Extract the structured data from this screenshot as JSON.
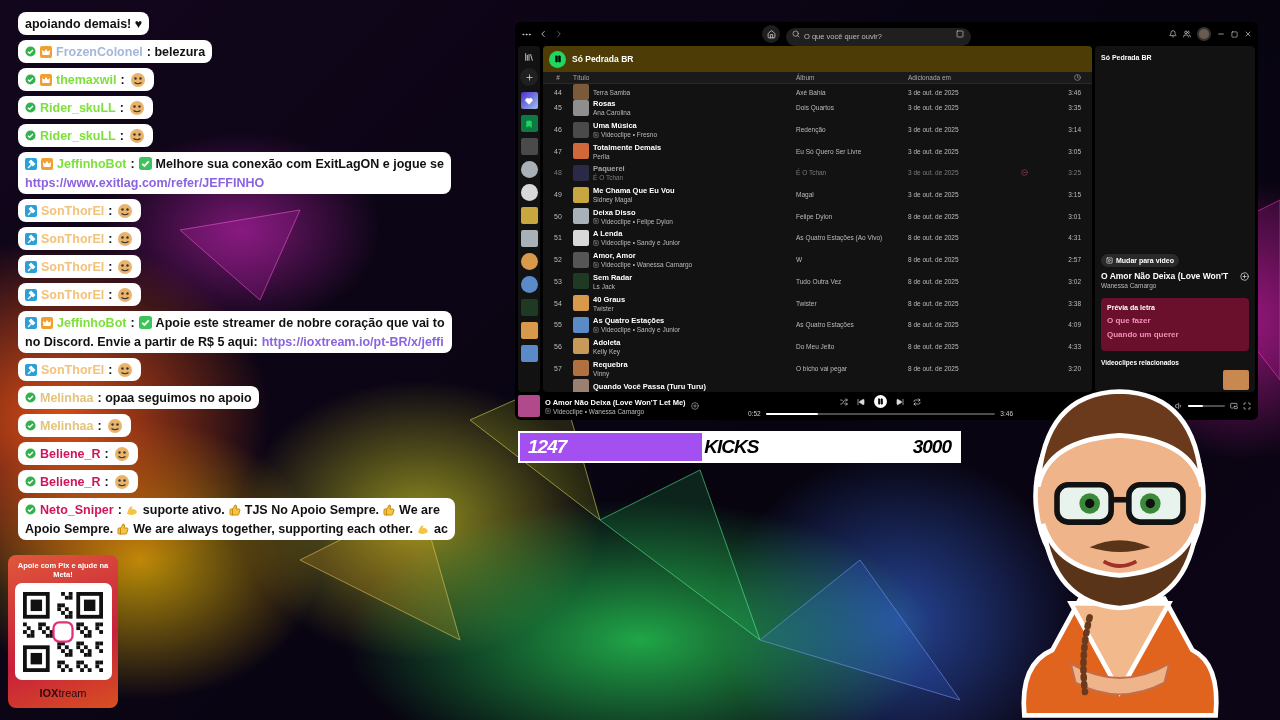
{
  "chat": {
    "messages": [
      {
        "lines": [
          [
            {
              "kind": "text",
              "text": "apoiando demais! ♥"
            }
          ]
        ]
      },
      {
        "badges": [
          {
            "kind": "verified"
          },
          {
            "kind": "crown"
          }
        ],
        "user": "FrozenColonel",
        "color": "#a3b6dc",
        "lines": [
          [
            {
              "kind": "text",
              "text": ": belezura"
            }
          ]
        ]
      },
      {
        "badges": [
          {
            "kind": "verified"
          },
          {
            "kind": "crown"
          }
        ],
        "user": "themaxwil",
        "color": "#7ee03a",
        "lines": [
          [
            {
              "kind": "text",
              "text": ":"
            },
            {
              "kind": "emote"
            }
          ]
        ]
      },
      {
        "badges": [
          {
            "kind": "verified"
          }
        ],
        "user": "Rider_skuLL",
        "color": "#7ee03a",
        "lines": [
          [
            {
              "kind": "text",
              "text": ":"
            },
            {
              "kind": "emote"
            }
          ]
        ]
      },
      {
        "badges": [
          {
            "kind": "verified"
          }
        ],
        "user": "Rider_skuLL",
        "color": "#7ee03a",
        "lines": [
          [
            {
              "kind": "text",
              "text": ":"
            },
            {
              "kind": "emote"
            }
          ]
        ]
      },
      {
        "badges": [
          {
            "kind": "mod"
          },
          {
            "kind": "crown"
          }
        ],
        "user": "JeffinhoBot",
        "color": "#7ee03a",
        "lines": [
          [
            {
              "kind": "text",
              "text": ":"
            },
            {
              "kind": "check"
            },
            {
              "kind": "text",
              "text": "Melhore sua conexão com ExitLagON e jogue se"
            }
          ],
          [
            {
              "kind": "link",
              "text": "https://www.exitlag.com/refer/JEFFINHO"
            }
          ]
        ]
      },
      {
        "badges": [
          {
            "kind": "mod"
          }
        ],
        "user": "SonThorEl",
        "color": "#f2c27a",
        "lines": [
          [
            {
              "kind": "text",
              "text": ":"
            },
            {
              "kind": "emote"
            }
          ]
        ]
      },
      {
        "badges": [
          {
            "kind": "mod"
          }
        ],
        "user": "SonThorEl",
        "color": "#f2c27a",
        "lines": [
          [
            {
              "kind": "text",
              "text": ":"
            },
            {
              "kind": "emote"
            }
          ]
        ]
      },
      {
        "badges": [
          {
            "kind": "mod"
          }
        ],
        "user": "SonThorEl",
        "color": "#f2c27a",
        "lines": [
          [
            {
              "kind": "text",
              "text": ":"
            },
            {
              "kind": "emote"
            }
          ]
        ]
      },
      {
        "badges": [
          {
            "kind": "mod"
          }
        ],
        "user": "SonThorEl",
        "color": "#f2c27a",
        "lines": [
          [
            {
              "kind": "text",
              "text": ":"
            },
            {
              "kind": "emote"
            }
          ]
        ]
      },
      {
        "badges": [
          {
            "kind": "mod"
          },
          {
            "kind": "crown"
          }
        ],
        "user": "JeffinhoBot",
        "color": "#7ee03a",
        "lines": [
          [
            {
              "kind": "text",
              "text": ":"
            },
            {
              "kind": "check"
            },
            {
              "kind": "text",
              "text": "Apoie este streamer de nobre coração que vai to"
            }
          ],
          [
            {
              "kind": "text",
              "text": "no Discord. Envie a partir de R$ 5 aqui:"
            },
            {
              "kind": "link",
              "text": "https://ioxtream.io/pt-BR/x/jeffi"
            }
          ]
        ]
      },
      {
        "badges": [
          {
            "kind": "mod"
          }
        ],
        "user": "SonThorEl",
        "color": "#f2c27a",
        "lines": [
          [
            {
              "kind": "text",
              "text": ":"
            },
            {
              "kind": "emote"
            }
          ]
        ]
      },
      {
        "badges": [
          {
            "kind": "verified"
          }
        ],
        "user": "Melinhaa",
        "color": "#e3c47a",
        "lines": [
          [
            {
              "kind": "text",
              "text": ": opaa seguimos no apoio"
            }
          ]
        ]
      },
      {
        "badges": [
          {
            "kind": "verified"
          }
        ],
        "user": "Melinhaa",
        "color": "#e3c47a",
        "lines": [
          [
            {
              "kind": "text",
              "text": ":"
            },
            {
              "kind": "emote"
            }
          ]
        ]
      },
      {
        "badges": [
          {
            "kind": "verified"
          }
        ],
        "user": "Beliene_R",
        "color": "#d1155a",
        "lines": [
          [
            {
              "kind": "text",
              "text": ":"
            },
            {
              "kind": "emote"
            }
          ]
        ]
      },
      {
        "badges": [
          {
            "kind": "verified"
          }
        ],
        "user": "Beliene_R",
        "color": "#d1155a",
        "lines": [
          [
            {
              "kind": "text",
              "text": ":"
            },
            {
              "kind": "emote"
            }
          ]
        ]
      },
      {
        "badges": [
          {
            "kind": "verified"
          }
        ],
        "user": "Neto_Sniper",
        "color": "#d1155a",
        "lines": [
          [
            {
              "kind": "text",
              "text": ":"
            },
            {
              "kind": "muscle"
            },
            {
              "kind": "text",
              "text": "suporte ativo."
            },
            {
              "kind": "thumbs"
            },
            {
              "kind": "text",
              "text": "TJS No Apoio Sempre."
            },
            {
              "kind": "thumbs"
            },
            {
              "kind": "text",
              "text": "We are"
            }
          ],
          [
            {
              "kind": "text",
              "text": "Apoio Sempre."
            },
            {
              "kind": "thumbs"
            },
            {
              "kind": "text",
              "text": "We are always together, supporting each other."
            },
            {
              "kind": "muscle"
            },
            {
              "kind": "text",
              "text": "ac"
            }
          ]
        ]
      }
    ]
  },
  "player_window": {
    "search": {
      "placeholder": "O que você quer ouvir?"
    },
    "library": [
      {
        "kind": "liked"
      },
      {
        "kind": "saved"
      },
      {
        "kind": "playlist"
      },
      {
        "kind": "artist"
      },
      {
        "kind": "artist"
      },
      {
        "kind": "playlist"
      },
      {
        "kind": "playlist"
      },
      {
        "kind": "artist"
      },
      {
        "kind": "artist"
      },
      {
        "kind": "playlist"
      },
      {
        "kind": "playlist"
      },
      {
        "kind": "playlist"
      }
    ],
    "playlist": {
      "title": "Só Pedrada BR",
      "playing": true
    },
    "columns": [
      "#",
      "Título",
      "Álbum",
      "Adicionada em"
    ],
    "tracks": [
      {
        "number": "44",
        "subtitle": "Terra Samba",
        "video": false,
        "album": "Axé Bahia",
        "added": "3 de out. de 2025",
        "duration": "3:46",
        "disabled": false
      },
      {
        "number": "45",
        "title": "Rosas",
        "subtitle": "Ana Carolina",
        "video": false,
        "album": "Dois Quartos",
        "added": "3 de out. de 2025",
        "duration": "3:35",
        "disabled": false
      },
      {
        "number": "46",
        "title": "Uma Música",
        "subtitle": "Videoclipe • Fresno",
        "video": true,
        "album": "Redenção",
        "added": "3 de out. de 2025",
        "duration": "3:14",
        "disabled": false
      },
      {
        "number": "47",
        "title": "Totalmente Demais",
        "subtitle": "Perlla",
        "video": false,
        "album": "Eu Só Quero Ser Livre",
        "added": "3 de out. de 2025",
        "duration": "3:05",
        "disabled": false
      },
      {
        "number": "48",
        "title": "Paquerei",
        "subtitle": "É O Tchan",
        "video": false,
        "album": "É O Tchan",
        "added": "3 de out. de 2025",
        "duration": "3:25",
        "disabled": true
      },
      {
        "number": "49",
        "title": "Me Chama Que Eu Vou",
        "subtitle": "Sidney Magal",
        "video": false,
        "album": "Magal",
        "added": "3 de out. de 2025",
        "duration": "3:15",
        "disabled": false
      },
      {
        "number": "50",
        "title": "Deixa Disso",
        "subtitle": "Videoclipe • Felipe Dylon",
        "video": true,
        "album": "Felipe Dylon",
        "added": "8 de out. de 2025",
        "duration": "3:01",
        "disabled": false
      },
      {
        "number": "51",
        "title": "A Lenda",
        "subtitle": "Videoclipe • Sandy e Junior",
        "video": true,
        "album": "As Quatro Estações (Ao Vivo)",
        "added": "8 de out. de 2025",
        "duration": "4:31",
        "disabled": false
      },
      {
        "number": "52",
        "title": "Amor, Amor",
        "subtitle": "Videoclipe • Wanessa Camargo",
        "video": true,
        "album": "W",
        "added": "8 de out. de 2025",
        "duration": "2:57",
        "disabled": false
      },
      {
        "number": "53",
        "title": "Sem Radar",
        "subtitle": "Ls Jack",
        "video": false,
        "album": "Tudo Outra Vez",
        "added": "8 de out. de 2025",
        "duration": "3:02",
        "disabled": false
      },
      {
        "number": "54",
        "title": "40 Graus",
        "subtitle": "Twister",
        "video": false,
        "album": "Twister",
        "added": "8 de out. de 2025",
        "duration": "3:38",
        "disabled": false
      },
      {
        "number": "55",
        "title": "As Quatro Estações",
        "subtitle": "Videoclipe • Sandy e Junior",
        "video": true,
        "album": "As Quatro Estações",
        "added": "8 de out. de 2025",
        "duration": "4:09",
        "disabled": false
      },
      {
        "number": "56",
        "title": "Adoleta",
        "subtitle": "Kelly Key",
        "video": false,
        "album": "Do Meu Jeito",
        "added": "8 de out. de 2025",
        "duration": "4:33",
        "disabled": false
      },
      {
        "number": "57",
        "title": "Requebra",
        "subtitle": "Vinny",
        "video": false,
        "album": "O bicho vai pegar",
        "added": "8 de out. de 2025",
        "duration": "3:20",
        "disabled": false
      },
      {
        "title": "Quando Você Passa (Turu Turu)",
        "disabled": false
      }
    ],
    "side_panel": {
      "title": "Só Pedrada BR",
      "switch_button": "Mudar para vídeo",
      "track_title": "O Amor Não Deixa (Love Won'T",
      "artist": "Wanessa Camargo",
      "lyrics": {
        "heading": "Prévia da letra",
        "lines": [
          "O que fazer",
          "Quando um querer"
        ]
      },
      "related_heading": "Videoclipes relacionados"
    },
    "now_playing": {
      "title": "O Amor Não Deixa (Love Won'T Let Me)",
      "subtitle": "Videoclipe • Wanessa Camargo",
      "video": true,
      "playing": true,
      "elapsed": "0:52",
      "total": "3:46",
      "level": 0.23,
      "volume": {
        "level": 0.4
      }
    }
  },
  "goal_bar": {
    "current": "1247",
    "label": "KICKS",
    "target": "3000",
    "level": 0.4157
  },
  "donation_card": {
    "title": "Apoie com Pix e ajude na Meta!",
    "brand": "**IOX**tream"
  }
}
